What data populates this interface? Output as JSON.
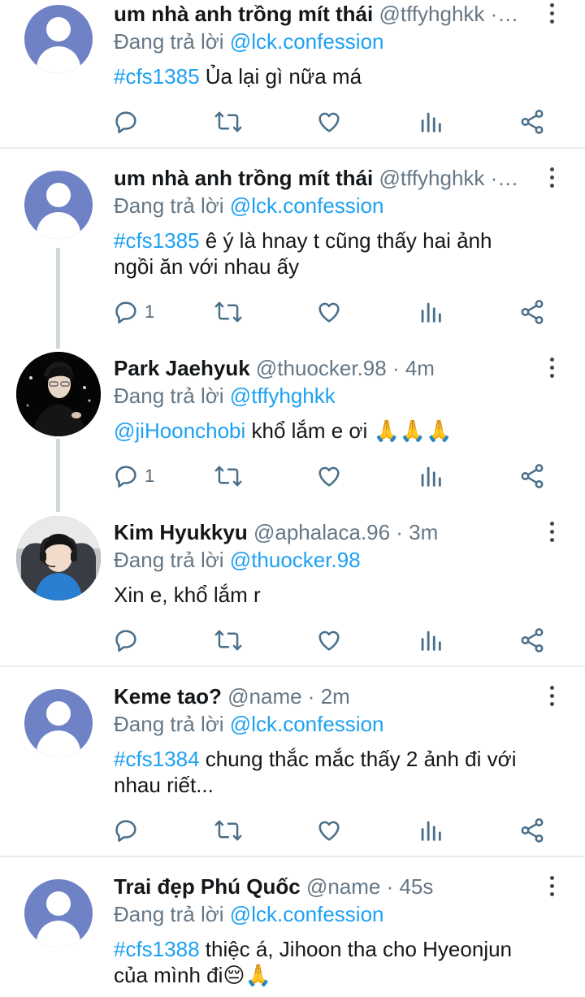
{
  "reply_prefix": "Đang trả lời",
  "tweets": [
    {
      "name": "um nhà anh trồng mít thái",
      "meta": "@tffyhghkk ·…",
      "reply_to": "@lck.confession",
      "tag": "#cfs1385",
      "text": " Ủa lại gì nữa má",
      "reply_count": "",
      "avatar": "default-avatar"
    },
    {
      "name": "um nhà anh trồng mít thái",
      "meta": "@tffyhghkk ·…",
      "reply_to": "@lck.confession",
      "tag": "#cfs1385",
      "text": " ê ý là hnay t cũng thấy hai ảnh ngồi ăn với nhau ấy",
      "reply_count": "1",
      "avatar": "default-avatar"
    },
    {
      "name": "Park Jaehyuk",
      "meta": "@thuocker.98 · 4m",
      "reply_to": "@tffyhghkk",
      "tag": "@jiHoonchobi",
      "text": " khổ lắm e ơi 🙏🙏🙏",
      "reply_count": "1",
      "avatar": "photo-avatar"
    },
    {
      "name": "Kim Hyukkyu",
      "meta": "@aphalaca.96 · 3m",
      "reply_to": "@thuocker.98",
      "tag": "",
      "text": "Xin e, khổ lắm r",
      "reply_count": "",
      "avatar": "photo-avatar"
    },
    {
      "name": "Keme tao?",
      "meta": "@name · 2m",
      "reply_to": "@lck.confession",
      "tag": "#cfs1384",
      "text": " chung thắc mắc thấy 2 ảnh đi với nhau riết...",
      "reply_count": "",
      "avatar": "default-avatar"
    },
    {
      "name": "Trai đẹp Phú Quốc",
      "meta": "@name · 45s",
      "reply_to": "@lck.confession",
      "tag": "#cfs1388",
      "text": " thiệc á, Jihoon tha cho Hyeonjun của mình đi😔🙏",
      "reply_count": "",
      "avatar": "default-avatar"
    }
  ],
  "colors": {
    "link": "#1da1f2",
    "secondary_text": "#657786",
    "icon": "#4a6f8a",
    "avatar_default": "#6f82c6",
    "divider": "#e6ecf0"
  },
  "icons": [
    "reply-icon",
    "retweet-icon",
    "like-icon",
    "analytics-icon",
    "share-icon",
    "more-icon"
  ]
}
